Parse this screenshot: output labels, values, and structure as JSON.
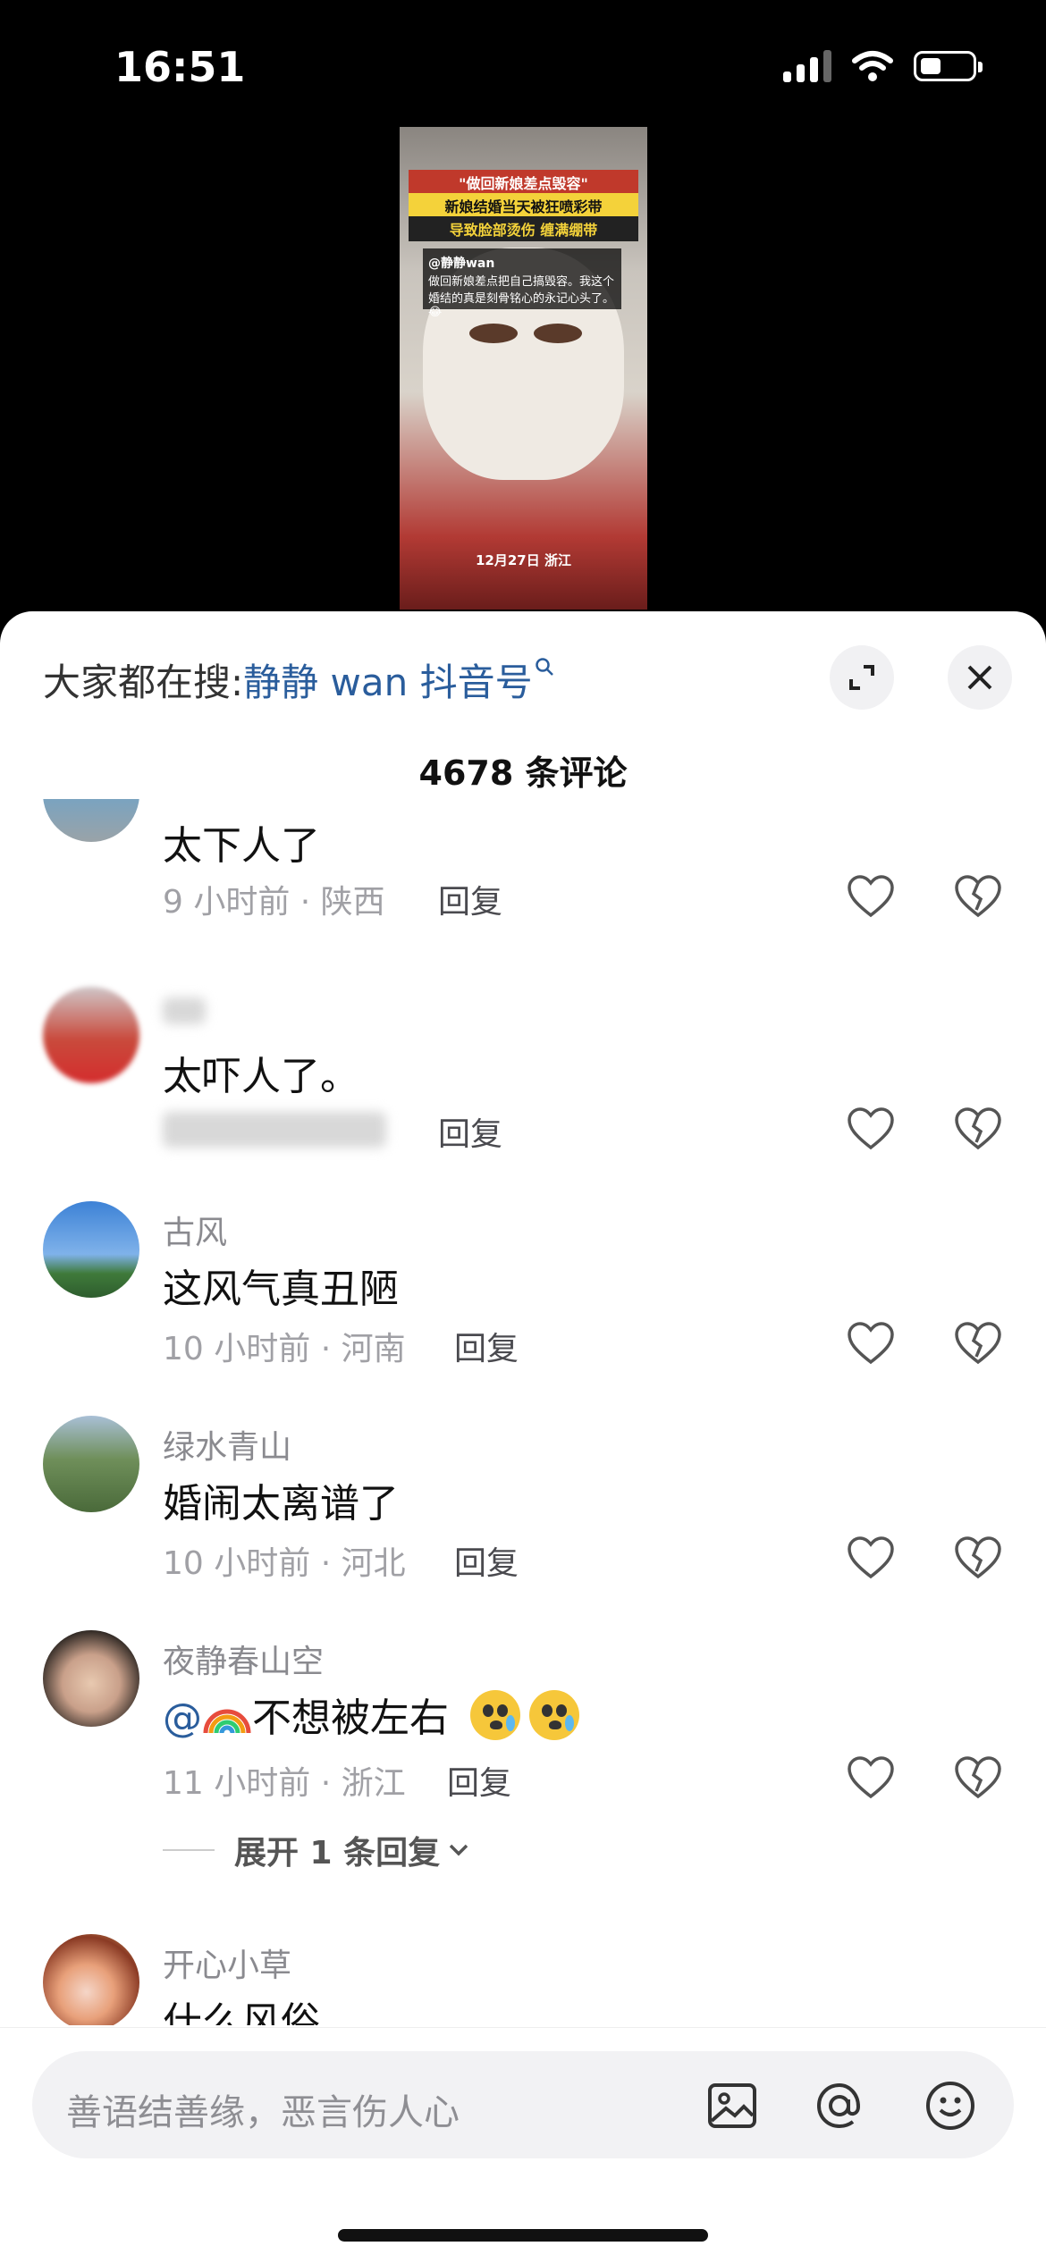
{
  "status": {
    "time": "16:51",
    "signal_bars": 3,
    "battery_level": 0.35
  },
  "video": {
    "caption_title": "\"做回新娘差点毁容\"",
    "caption_line2": "新娘结婚当天被狂喷彩带",
    "caption_line3": "导致脸部烫伤 缠满绷带",
    "post_user": "@静静wan",
    "post_text": "做回新娘差点把自己搞毁容。我这个婚结的真是刻骨铭心的永记心头了。😂",
    "date_location": "12月27日 浙江"
  },
  "sheet": {
    "search_prefix": "大家都在搜:",
    "search_link": "静静 wan 抖音号",
    "comment_count_title": "4678 条评论"
  },
  "comments": [
    {
      "username": "",
      "text": "太下人了",
      "time_location": "9 小时前 · 陕西",
      "reply_label": "回复"
    },
    {
      "username": "",
      "text": "太吓人了。",
      "time_location": "",
      "reply_label": "回复"
    },
    {
      "username": "古风",
      "text": "这风气真丑陋",
      "time_location": "10 小时前 · 河南",
      "reply_label": "回复"
    },
    {
      "username": "绿水青山",
      "text": "婚闹太离谱了",
      "time_location": "10 小时前 · 河北",
      "reply_label": "回复"
    },
    {
      "username": "夜静春山空",
      "mention": "@",
      "text_after": "不想被左右",
      "time_location": "11 小时前 · 浙江",
      "reply_label": "回复"
    },
    {
      "username": "开心小草",
      "text": "什么风俗",
      "time_location": "",
      "reply_label": ""
    }
  ],
  "expand_replies": "展开 1 条回复",
  "input": {
    "placeholder": "善语结善缘，恶言伤人心"
  },
  "icons": [
    "image-icon",
    "at-icon",
    "emoji-icon",
    "expand-icon",
    "close-icon",
    "heart-icon",
    "broken-heart-icon",
    "search-icon"
  ]
}
